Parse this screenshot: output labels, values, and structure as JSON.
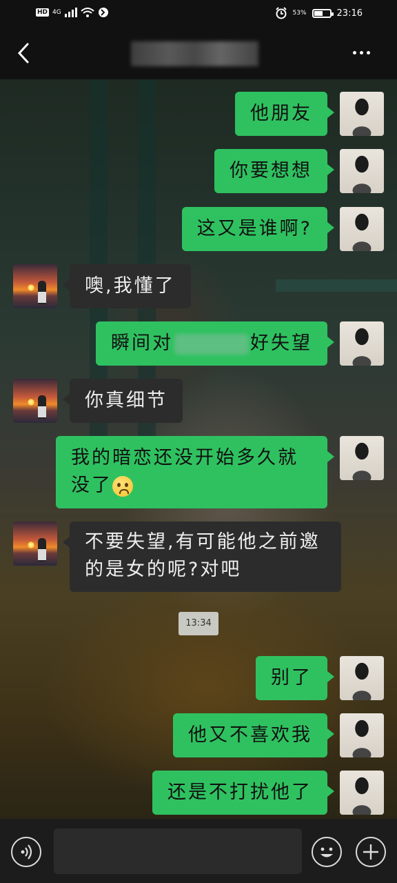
{
  "status_bar": {
    "network_badge": "HD",
    "network_type": "4G",
    "battery_text": "53%",
    "battery_level": 0.53,
    "time": "23:16",
    "icons": [
      "signal-icon",
      "wifi-icon",
      "hotspot-icon",
      "alarm-icon",
      "battery-icon"
    ]
  },
  "header": {
    "back_icon": "chevron-left-icon",
    "title": "",
    "more_icon": "more-dots-icon"
  },
  "messages": [
    {
      "sender": "me",
      "text": "他朋友"
    },
    {
      "sender": "me",
      "text": "你要想想"
    },
    {
      "sender": "me",
      "text": "这又是谁啊?"
    },
    {
      "sender": "other",
      "text": "噢,我懂了"
    },
    {
      "sender": "me",
      "text_before": "瞬间对",
      "text_after": "好失望"
    },
    {
      "sender": "other",
      "text": "你真细节"
    },
    {
      "sender": "me",
      "text": "我的暗恋还没开始多久就没了"
    },
    {
      "sender": "other",
      "text": "不要失望,有可能他之前邀的是女的呢?对吧"
    },
    {
      "sender": "me",
      "text": "别了"
    },
    {
      "sender": "me",
      "text": "他又不喜欢我"
    },
    {
      "sender": "me",
      "text": "还是不打扰他了"
    }
  ],
  "timestamp": "13:34",
  "input_bar": {
    "voice_icon": "voice-icon",
    "emoji_icon": "smiley-icon",
    "plus_icon": "plus-icon",
    "placeholder": ""
  },
  "colors": {
    "my_bubble": "#2fc160",
    "other_bubble": "#2c2c2c",
    "bar_background": "#111111"
  }
}
